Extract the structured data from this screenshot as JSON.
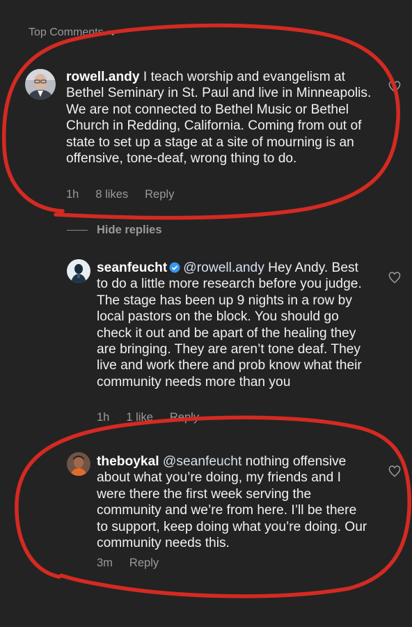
{
  "header": {
    "title": "Top Comments"
  },
  "comments": [
    {
      "username": "rowell.andy",
      "text": "I teach worship and evangelism at Bethel Seminary in St. Paul and live in Minneapolis. We are not connected to Bethel Music or Bethel Church in Redding, California. Coming from out of state to set up a stage at a site of mourning is an offensive, tone-deaf, wrong thing to do.",
      "time": "1h",
      "likes": "8 likes",
      "reply": "Reply"
    },
    {
      "username": "seanfeucht",
      "mention": "@rowell.andy",
      "text": "Hey Andy. Best to do a little more research before you judge. The stage has been up 9 nights in a row by local pastors on the block. You should go check it out and be apart of the healing they are bringing. They are aren’t tone deaf. They live and work there and prob know what their community needs more than you",
      "time": "1h",
      "likes": "1 like",
      "reply": "Reply"
    },
    {
      "username": "theboykal",
      "mention": "@seanfeucht",
      "text": "nothing offensive about what you’re doing, my friends and I were there the first week serving the community and we’re from here. I’ll be there to support, keep doing what you’re doing. Our community needs this.",
      "time": "3m",
      "reply": "Reply"
    }
  ],
  "thread": {
    "hide_replies": "Hide replies"
  },
  "colors": {
    "background": "#232323",
    "annotation": "#d42a22",
    "muted_text": "#9a9a9a",
    "verified": "#3897f0"
  },
  "icons": [
    "chevron-down-icon",
    "heart-icon",
    "verified-badge-icon"
  ]
}
